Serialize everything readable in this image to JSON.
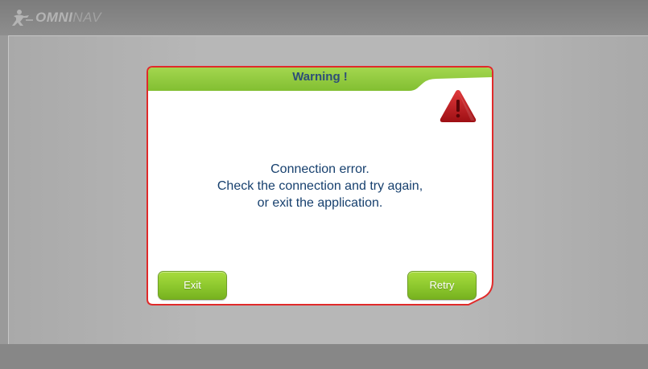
{
  "app": {
    "logo_text_main": "OMNI",
    "logo_text_tail": "NAV"
  },
  "colors": {
    "header_green": "#8cc63f",
    "dialog_border": "#e02a2a",
    "title_text": "#2e4e78",
    "message_text": "#17406e",
    "warning_red": "#c8141c"
  },
  "dialog": {
    "title": "Warning !",
    "icon": "warning-triangle-icon",
    "message_lines": [
      "Connection error.",
      "Check the connection and try again,",
      "or exit the application."
    ],
    "buttons": {
      "exit_label": "Exit",
      "retry_label": "Retry"
    }
  }
}
